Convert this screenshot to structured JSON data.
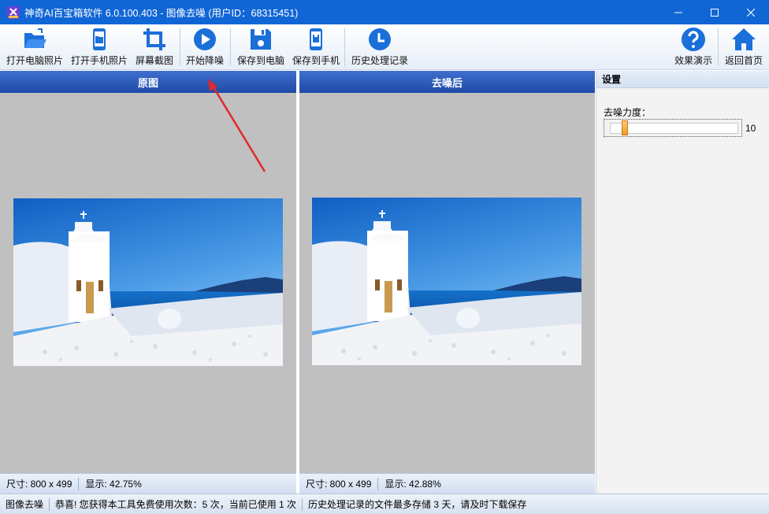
{
  "window": {
    "title": "神奇AI百宝箱软件 6.0.100.403 - 图像去噪 (用户ID：68315451)",
    "minimize_icon": "minimize-icon",
    "maximize_icon": "maximize-icon",
    "close_icon": "close-icon"
  },
  "toolbar": {
    "open_pc": "打开电脑照片",
    "open_phone": "打开手机照片",
    "screenshot": "屏幕截图",
    "start": "开始降噪",
    "save_pc": "保存到电脑",
    "save_phone": "保存到手机",
    "history": "历史处理记录",
    "demo": "效果演示",
    "home": "返回首页"
  },
  "original_panel": {
    "title": "原图",
    "size_text": "尺寸: 800 x 499",
    "display_text": "显示: 42.75%"
  },
  "result_panel": {
    "title": "去噪后",
    "size_text": "尺寸: 800 x 499",
    "display_text": "显示: 42.88%"
  },
  "settings": {
    "title": "设置",
    "strength_label": "去噪力度：",
    "strength_value": "10",
    "strength_fraction": 0.05
  },
  "statusbar": {
    "mode": "图像去噪",
    "usage": "恭喜! 您获得本工具免费使用次数：5 次，当前已使用 1 次",
    "notice": "历史处理记录的文件最多存储 3 天，请及时下载保存"
  },
  "colors": {
    "titlebar": "#1166d6",
    "accent": "#1a6fd9",
    "panel_header": "#2a56b5",
    "annotation_arrow": "#e0282e"
  }
}
